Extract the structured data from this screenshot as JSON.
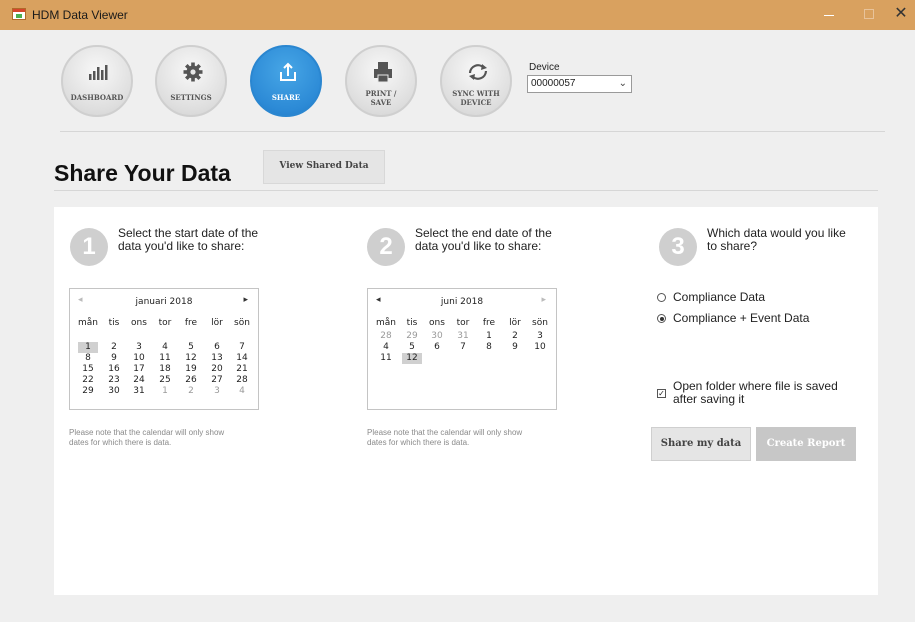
{
  "window": {
    "title": "HDM Data Viewer",
    "close": "✕"
  },
  "nav": [
    {
      "label": "DASHBOARD",
      "icon": "bar-chart-icon"
    },
    {
      "label": "SETTINGS",
      "icon": "gear-icon"
    },
    {
      "label": "SHARE",
      "icon": "share-upload-icon",
      "active": true
    },
    {
      "label_line1": "PRINT /",
      "label_line2": "SAVE",
      "icon": "printer-icon"
    },
    {
      "label_line1": "SYNC WITH",
      "label_line2": "DEVICE",
      "icon": "sync-icon"
    }
  ],
  "device": {
    "label": "Device",
    "value": "00000057"
  },
  "page": {
    "title": "Share Your Data",
    "view_shared_label": "View Shared Data"
  },
  "step1": {
    "number": "1",
    "line1": "Select the start date of the",
    "line2": "data you'd like to share:",
    "note1": "Please note that the calendar will only show",
    "note2": "dates for which there is data.",
    "calendar": {
      "month": "januari 2018",
      "prev": "◂",
      "next": "▸",
      "dow": [
        "mån",
        "tis",
        "ons",
        "tor",
        "fre",
        "lör",
        "sön"
      ],
      "weeks": [
        [
          "1",
          "2",
          "3",
          "4",
          "5",
          "6",
          "7"
        ],
        [
          "8",
          "9",
          "10",
          "11",
          "12",
          "13",
          "14"
        ],
        [
          "15",
          "16",
          "17",
          "18",
          "19",
          "20",
          "21"
        ],
        [
          "22",
          "23",
          "24",
          "25",
          "26",
          "27",
          "28"
        ],
        [
          "29",
          "30",
          "31",
          "1",
          "2",
          "3",
          "4"
        ]
      ],
      "highlighted": "1"
    }
  },
  "step2": {
    "number": "2",
    "line1": "Select the end date of the",
    "line2": "data you'd like to share:",
    "note1": "Please note that the calendar will only show",
    "note2": "dates for which there is data.",
    "calendar": {
      "month": "juni 2018",
      "prev": "◂",
      "next": "▸",
      "dow": [
        "mån",
        "tis",
        "ons",
        "tor",
        "fre",
        "lör",
        "sön"
      ],
      "weeks": [
        [
          "28",
          "29",
          "30",
          "31",
          "1",
          "2",
          "3"
        ],
        [
          "4",
          "5",
          "6",
          "7",
          "8",
          "9",
          "10"
        ],
        [
          "11",
          "12"
        ]
      ],
      "highlighted": "12"
    }
  },
  "step3": {
    "number": "3",
    "line1": "Which data would you like",
    "line2": "to share?",
    "option1": "Compliance Data",
    "option2": "Compliance + Event Data",
    "selected_option": "Compliance + Event Data",
    "open_folder_line1": "Open folder where file is saved",
    "open_folder_line2": "after saving it",
    "open_folder_checked": true,
    "check_mark": "✓",
    "share_button": "Share my data",
    "report_button": "Create Report"
  }
}
